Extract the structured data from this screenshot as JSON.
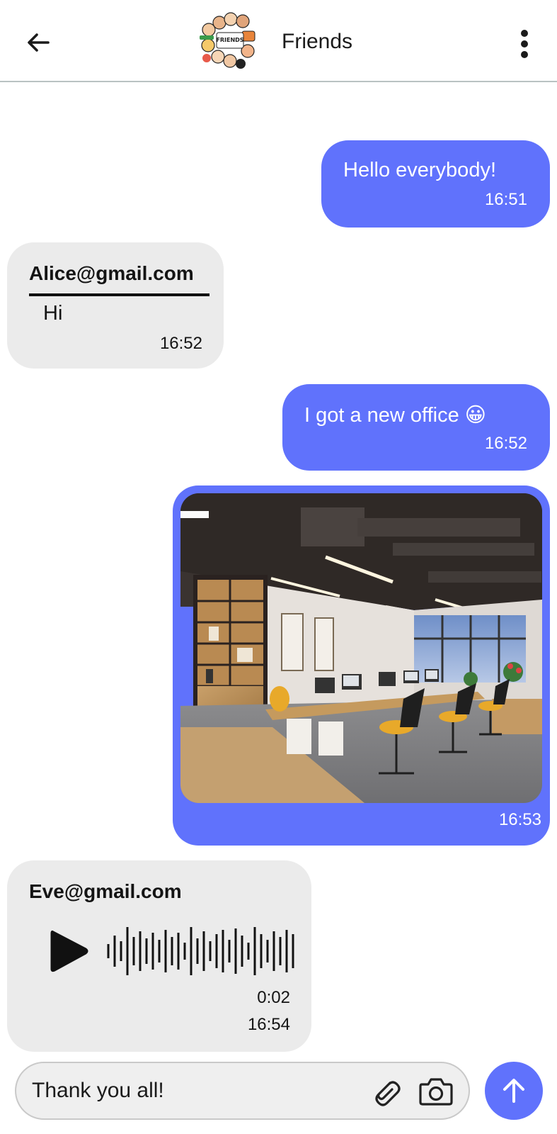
{
  "header": {
    "title": "Friends",
    "back_icon": "arrow-left-icon",
    "menu_icon": "more-vert-icon",
    "avatar_logo_text": "FRIENDS"
  },
  "colors": {
    "outgoing_bubble": "#6072fc",
    "incoming_bubble": "#ebebeb",
    "send_button": "#6072fc"
  },
  "messages": [
    {
      "direction": "out",
      "text": "Hello everybody!",
      "time": "16:51"
    },
    {
      "direction": "in",
      "sender": "Alice@gmail.com",
      "text": "Hi",
      "time": "16:52"
    },
    {
      "direction": "out",
      "text": "I got a new office 😀",
      "time": "16:52"
    },
    {
      "direction": "out",
      "type": "image",
      "image": "office-photo",
      "time": "16:53"
    },
    {
      "direction": "in",
      "type": "voice",
      "sender": "Eve@gmail.com",
      "duration": "0:02",
      "time": "16:54"
    }
  ],
  "composer": {
    "value": "Thank you all!",
    "attach_icon": "paperclip-icon",
    "camera_icon": "camera-icon",
    "send_icon": "arrow-up-icon"
  }
}
